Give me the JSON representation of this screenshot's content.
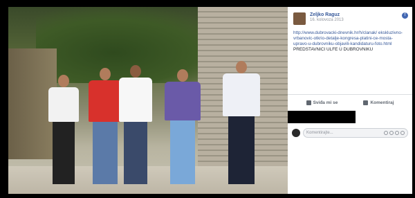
{
  "post": {
    "author": "Zeljko Raguz",
    "date": "16. kolovoza 2013",
    "link": "http://www.dubrovacki-dnevnik.hr/h/clanak/ ekskluzivno-vrbanovic-otkrio-detalje-kongresa-platini-ce-mosta-upravo-u-dubrovniku-objavili-kandidaturu-foto.html",
    "caption": "PREDSTAVNICI ULFE U DUBROVNIKU"
  },
  "actions": {
    "like": "Sviđa mi se",
    "comment": "Komentiraj"
  },
  "comment_box": {
    "placeholder": "Komentirajte..."
  },
  "colors": {
    "link": "#365899",
    "brand": "#4267b2"
  }
}
